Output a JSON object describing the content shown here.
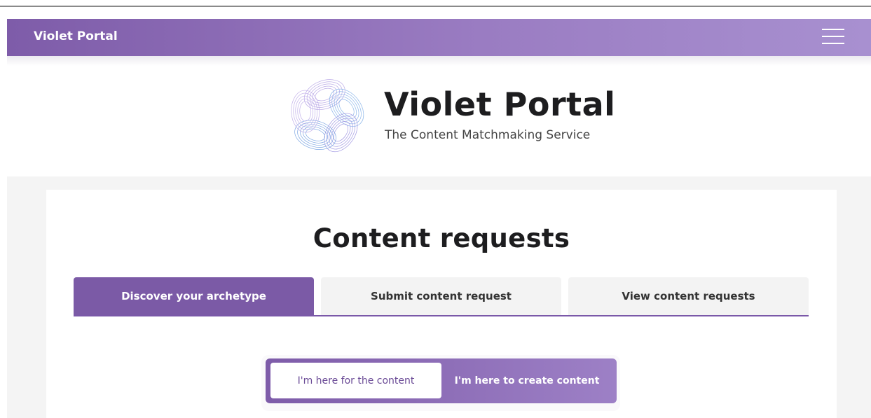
{
  "navbar": {
    "brand": "Violet Portal",
    "menu_icon": "hamburger-menu-icon",
    "gradient_start": "#7e5ca9",
    "gradient_end": "#a890d0"
  },
  "hero": {
    "logo_icon": "swirl-logo-icon",
    "title": "Violet Portal",
    "subtitle": "The Content Matchmaking Service"
  },
  "main": {
    "title": "Content requests",
    "tabs": [
      {
        "label": "Discover your archetype",
        "active": true
      },
      {
        "label": "Submit content request",
        "active": false
      },
      {
        "label": "View content requests",
        "active": false
      }
    ],
    "toggle": {
      "options": [
        {
          "label": "I'm here for the content",
          "selected": true
        },
        {
          "label": "I'm here to create content",
          "selected": false
        }
      ]
    }
  },
  "colors": {
    "accent": "#7b5aa6",
    "panel_background": "#f4f4f4"
  }
}
